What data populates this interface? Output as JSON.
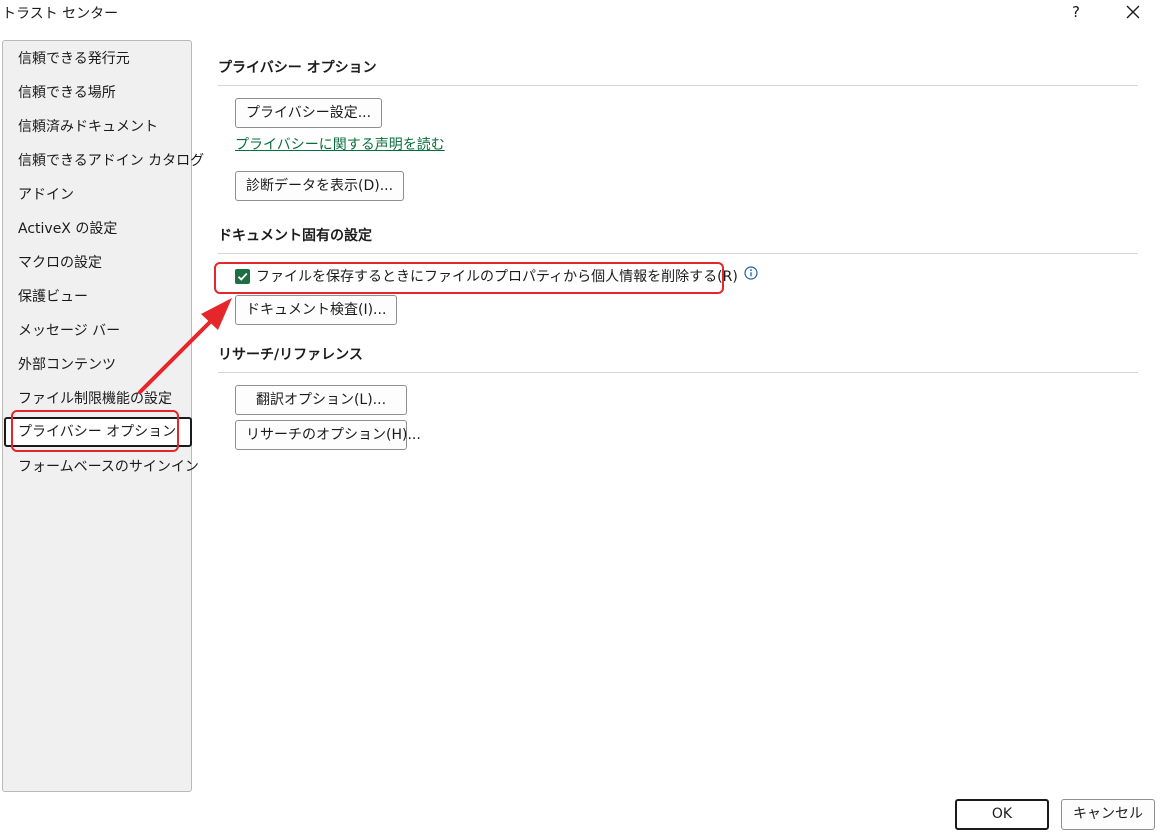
{
  "window": {
    "title": "トラスト センター",
    "help_label": "?",
    "close_icon": "close-icon"
  },
  "sidebar": {
    "items": [
      {
        "label": "信頼できる発行元"
      },
      {
        "label": "信頼できる場所"
      },
      {
        "label": "信頼済みドキュメント"
      },
      {
        "label": "信頼できるアドイン カタログ"
      },
      {
        "label": "アドイン"
      },
      {
        "label": "ActiveX の設定"
      },
      {
        "label": "マクロの設定"
      },
      {
        "label": "保護ビュー"
      },
      {
        "label": "メッセージ バー"
      },
      {
        "label": "外部コンテンツ"
      },
      {
        "label": "ファイル制限機能の設定"
      },
      {
        "label": "プライバシー オプション",
        "selected": true
      },
      {
        "label": "フォームベースのサインイン"
      }
    ]
  },
  "main": {
    "privacy": {
      "title": "プライバシー オプション",
      "settings_button": "プライバシー設定...",
      "statement_link": "プライバシーに関する声明を読む",
      "diagnostic_button": "診断データを表示(D)..."
    },
    "document": {
      "title": "ドキュメント固有の設定",
      "remove_info_checkbox_label": "ファイルを保存するときにファイルのプロパティから個人情報を削除する(R)",
      "remove_info_checked": true,
      "inspect_button": "ドキュメント検査(I)..."
    },
    "research": {
      "title": "リサーチ/リファレンス",
      "translation_button": "翻訳オプション(L)...",
      "research_button": "リサーチのオプション(H)..."
    }
  },
  "footer": {
    "ok_label": "OK",
    "cancel_label": "キャンセル"
  },
  "colors": {
    "accent_green": "#1e6e43",
    "link_green": "#0a6e3c",
    "annotation_red": "#e5262a"
  }
}
